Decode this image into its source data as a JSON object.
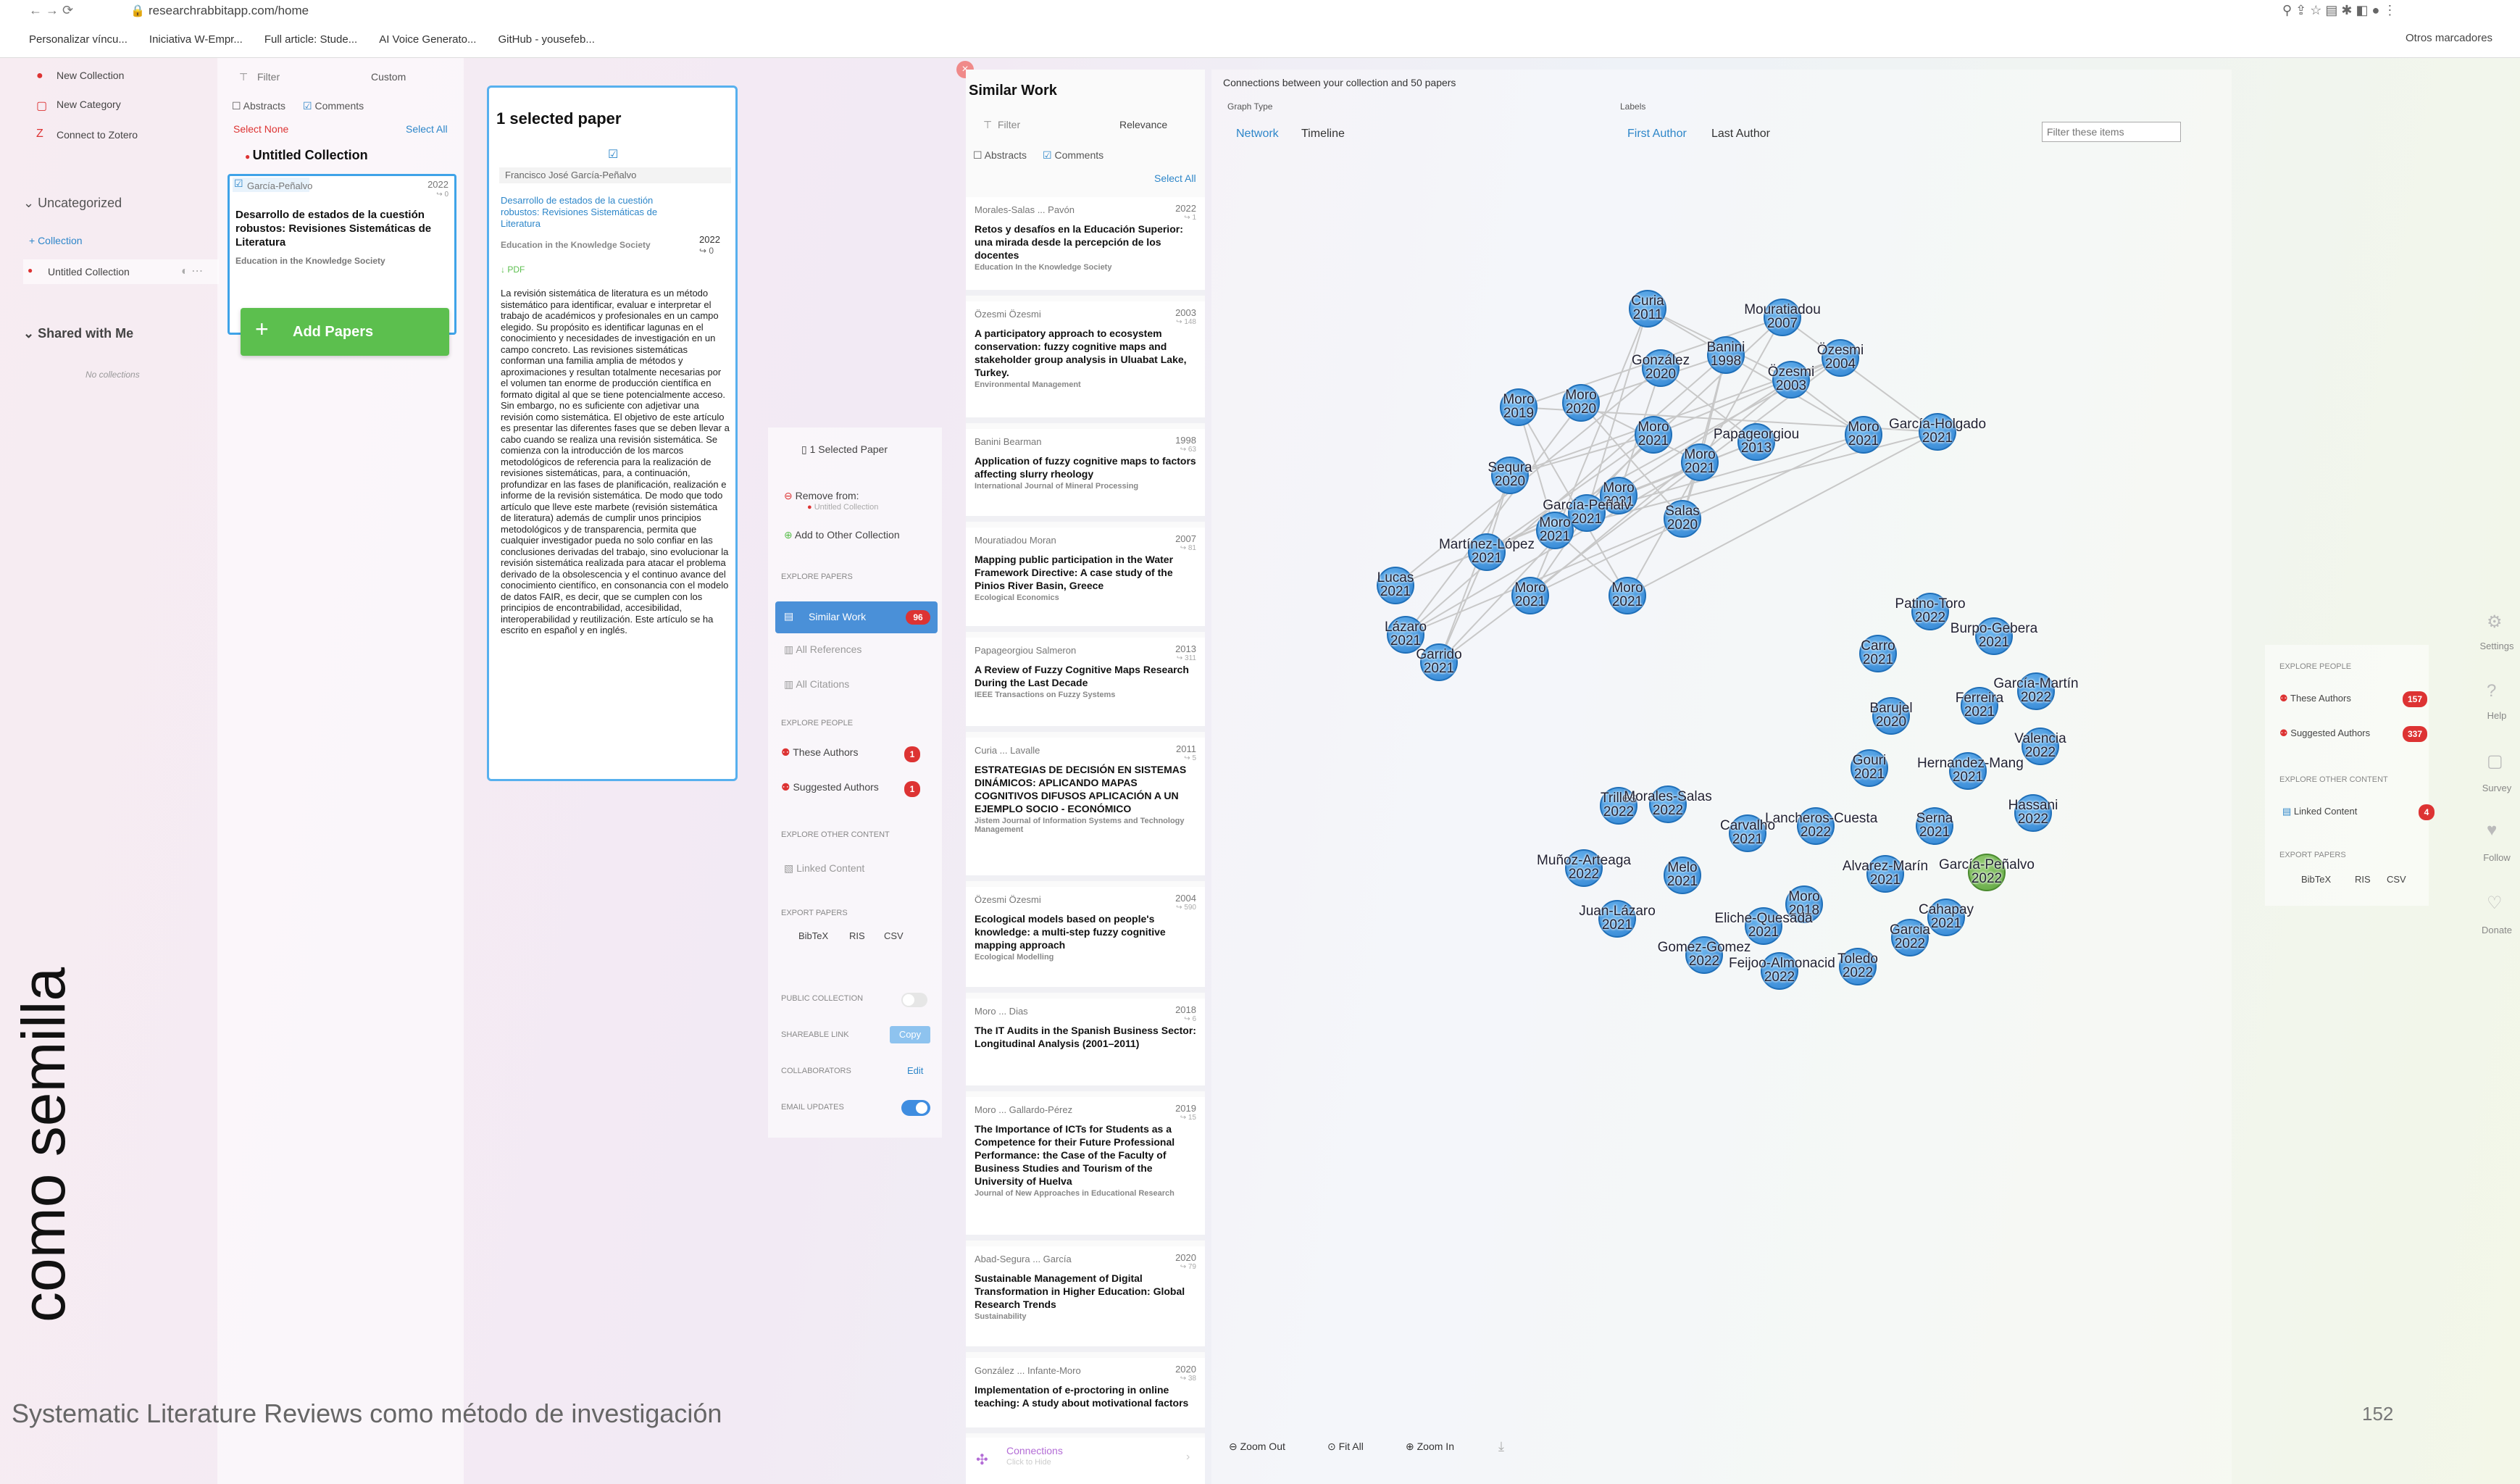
{
  "browser": {
    "url": "researchrabbitapp.com/home",
    "bookmarks": [
      "Personalizar víncu...",
      "Iniciativa W-Empr...",
      "Full article: Stude...",
      "AI Voice Generato...",
      "GitHub - yousefeb..."
    ],
    "other_bookmarks": "Otros marcadores"
  },
  "left_sidebar": {
    "new_collection": "New Collection",
    "new_category": "New Category",
    "connect_zotero": "Connect to Zotero",
    "uncategorized": "Uncategorized",
    "add_collection": "+ Collection",
    "untitled_collection": "Untitled Collection",
    "shared_with_me": "Shared with Me",
    "no_collections": "No collections"
  },
  "collection_panel": {
    "filter": "Filter",
    "sort": "Custom",
    "abstracts": "Abstracts",
    "comments": "Comments",
    "select_none": "Select None",
    "select_all": "Select All",
    "title": "Untitled Collection",
    "paper_author": "García-Peñalvo",
    "paper_year": "2022",
    "paper_cites": "0",
    "paper_title": "Desarrollo de estados de la cuestión robustos: Revisiones Sistemáticas de Literatura",
    "paper_journal": "Education in the Knowledge Society",
    "add_papers": "Add Papers"
  },
  "selected_panel": {
    "title": "1 selected paper",
    "author": "Francisco José García-Peñalvo",
    "paper_title": "Desarrollo de estados de la cuestión robustos: Revisiones Sistemáticas de Literatura",
    "journal": "Education in the Knowledge Society",
    "year": "2022",
    "cites": "0",
    "pdf": "PDF",
    "abstract": "La revisión sistemática de literatura es un método sistemático para identificar, evaluar e interpretar el trabajo de académicos y profesionales en un campo elegido. Su propósito es identificar lagunas en el conocimiento y necesidades de investigación en un campo concreto. Las revisiones sistemáticas conforman una familia amplia de métodos y aproximaciones y resultan totalmente necesarias por el volumen tan enorme de producción científica en formato digital al que se tiene potencialmente acceso. Sin embargo, no es suficiente con adjetivar una revisión como sistemática. El objetivo de este artículo es presentar las diferentes fases que se deben llevar a cabo cuando se realiza una revisión sistemática. Se comienza con la introducción de los marcos metodológicos de referencia para la realización de revisiones sistemáticas, para, a continuación, profundizar en las fases de planificación, realización e informe de la revisión sistemática. De modo que todo artículo que lleve este marbete (revisión sistemática de literatura) además de cumplir unos principios metodológicos y de transparencia, permita que cualquier investigador pueda no solo confiar en las conclusiones derivadas del trabajo, sino evolucionar la revisión sistemática realizada para atacar el problema derivado de la obsolescencia y el continuo avance del conocimiento científico, en consonancia con el modelo de datos FAIR, es decir, que se cumplen con los principios de encontrabilidad, accesibilidad, interoperabilidad y reutilización. Este artículo se ha escrito en español y en inglés."
  },
  "actions_panel": {
    "selected": "1 Selected Paper",
    "remove_from": "Remove from:",
    "remove_collection": "Untitled Collection",
    "add_other": "Add to Other Collection",
    "explore_papers": "EXPLORE PAPERS",
    "similar_work": "Similar Work",
    "similar_count": "96",
    "all_references": "All References",
    "all_citations": "All Citations",
    "explore_people": "EXPLORE PEOPLE",
    "these_authors": "These Authors",
    "these_count": "1",
    "suggested_authors": "Suggested Authors",
    "suggested_count": "1",
    "explore_other": "EXPLORE OTHER CONTENT",
    "linked_content": "Linked Content",
    "export_papers": "EXPORT PAPERS",
    "bibtex": "BibTeX",
    "ris": "RIS",
    "csv": "CSV",
    "public_collection": "PUBLIC COLLECTION",
    "shareable_link": "SHAREABLE LINK",
    "copy": "Copy",
    "collaborators": "COLLABORATORS",
    "edit": "Edit",
    "email_updates": "EMAIL UPDATES"
  },
  "similar_panel": {
    "title": "Similar Work",
    "filter": "Filter",
    "sort": "Relevance",
    "abstracts": "Abstracts",
    "comments": "Comments",
    "select_all": "Select All",
    "connections": "Connections",
    "click_hide": "Click to Hide",
    "items": [
      {
        "authors": "Morales-Salas  ...  Pavón",
        "year": "2022",
        "cites": "1",
        "title": "Retos y desafíos en la Educación Superior: una mirada desde la percepción de los docentes",
        "journal": "Education In the Knowledge Society"
      },
      {
        "authors": "Özesmi   Özesmi",
        "year": "2003",
        "cites": "148",
        "title": "A participatory approach to ecosystem conservation: fuzzy cognitive maps and stakeholder group analysis in Uluabat Lake, Turkey.",
        "journal": "Environmental Management"
      },
      {
        "authors": "Banini   Bearman",
        "year": "1998",
        "cites": "63",
        "title": "Application of fuzzy cognitive maps to factors affecting slurry rheology",
        "journal": "International Journal of Mineral Processing"
      },
      {
        "authors": "Mouratiadou   Moran",
        "year": "2007",
        "cites": "81",
        "title": "Mapping public participation in the Water Framework Directive: A case study of the Pinios River Basin, Greece",
        "journal": "Ecological Economics"
      },
      {
        "authors": "Papageorgiou   Salmeron",
        "year": "2013",
        "cites": "311",
        "title": "A Review of Fuzzy Cognitive Maps Research During the Last Decade",
        "journal": "IEEE Transactions on Fuzzy Systems"
      },
      {
        "authors": "Curia  ...  Lavalle",
        "year": "2011",
        "cites": "5",
        "title": "ESTRATEGIAS DE DECISIÓN EN SISTEMAS DINÁMICOS: APLICANDO MAPAS COGNITIVOS DIFUSOS APLICACIÓN A UN EJEMPLO SOCIO - ECONÓMICO",
        "journal": "Jistem Journal of Information Systems and Technology Management"
      },
      {
        "authors": "Özesmi   Özesmi",
        "year": "2004",
        "cites": "590",
        "title": "Ecological models based on people's knowledge: a multi-step fuzzy cognitive mapping approach",
        "journal": "Ecological Modelling"
      },
      {
        "authors": "Moro  ...  Dias",
        "year": "2018",
        "cites": "6",
        "title": "The IT Audits in the Spanish Business Sector: Longitudinal Analysis (2001–2011)",
        "journal": ""
      },
      {
        "authors": "Moro  ...  Gallardo-Pérez",
        "year": "2019",
        "cites": "15",
        "title": "The Importance of ICTs for Students as a Competence for their Future Professional Performance: the Case of the Faculty of Business Studies and Tourism of the University of Huelva",
        "journal": "Journal of New Approaches in Educational Research"
      },
      {
        "authors": "Abad-Segura  ...  García",
        "year": "2020",
        "cites": "79",
        "title": "Sustainable Management of Digital Transformation in Higher Education: Global Research Trends",
        "journal": "Sustainability"
      },
      {
        "authors": "González  ...  Infante-Moro",
        "year": "2020",
        "cites": "38",
        "title": "Implementation of e-proctoring in online teaching: A study about motivational factors",
        "journal": ""
      }
    ]
  },
  "graph_panel": {
    "header": "Connections between your collection and 50 papers",
    "graph_type": "Graph Type",
    "network": "Network",
    "timeline": "Timeline",
    "labels": "Labels",
    "first_author": "First Author",
    "last_author": "Last Author",
    "filter_placeholder": "Filter these items",
    "zoom_out": "Zoom Out",
    "fit_all": "Fit All",
    "zoom_in": "Zoom In",
    "nodes": [
      {
        "name": "Curia",
        "year": "2011"
      },
      {
        "name": "Mouratiadou",
        "year": "2007"
      },
      {
        "name": "Banini",
        "year": "1998"
      },
      {
        "name": "Özesmi",
        "year": "2004"
      },
      {
        "name": "González",
        "year": "2020"
      },
      {
        "name": "Özesmi",
        "year": "2003"
      },
      {
        "name": "Moro",
        "year": "2019"
      },
      {
        "name": "Moro",
        "year": "2020"
      },
      {
        "name": "Moro",
        "year": "2021"
      },
      {
        "name": "Papageorgiou",
        "year": "2013"
      },
      {
        "name": "Moro",
        "year": "2021"
      },
      {
        "name": "García-Holgado",
        "year": "2021"
      },
      {
        "name": "Moro",
        "year": "2021"
      },
      {
        "name": "Sequra",
        "year": "2020"
      },
      {
        "name": "Moro",
        "year": "2021"
      },
      {
        "name": "García-Peñalv",
        "year": "2021"
      },
      {
        "name": "Moro",
        "year": "2021"
      },
      {
        "name": "Salas",
        "year": "2020"
      },
      {
        "name": "Martínez-López",
        "year": "2021"
      },
      {
        "name": "Lucas",
        "year": "2021"
      },
      {
        "name": "Moro",
        "year": "2021"
      },
      {
        "name": "Moro",
        "year": "2021"
      },
      {
        "name": "Lázaro",
        "year": "2021"
      },
      {
        "name": "Garrido",
        "year": "2021"
      },
      {
        "name": "Patino-Toro",
        "year": "2022"
      },
      {
        "name": "Burpo-Gebera",
        "year": "2021"
      },
      {
        "name": "Carro",
        "year": "2021"
      },
      {
        "name": "García-Martín",
        "year": "2022"
      },
      {
        "name": "Barujel",
        "year": "2020"
      },
      {
        "name": "Ferreira",
        "year": "2021"
      },
      {
        "name": "Valencia",
        "year": "2022"
      },
      {
        "name": "Gouri",
        "year": "2021"
      },
      {
        "name": "Hernandez-Mang",
        "year": "2021"
      },
      {
        "name": "Trilles",
        "year": "2022"
      },
      {
        "name": "Morales-Salas",
        "year": "2022"
      },
      {
        "name": "Hassani",
        "year": "2022"
      },
      {
        "name": "Lancheros-Cuesta",
        "year": "2022"
      },
      {
        "name": "Carvalho",
        "year": "2021"
      },
      {
        "name": "Serna",
        "year": "2021"
      },
      {
        "name": "Muñoz-Arteaga",
        "year": "2022"
      },
      {
        "name": "Melo",
        "year": "2021"
      },
      {
        "name": "Alvarez-Marín",
        "year": "2021"
      },
      {
        "name": "García-Peñalvo",
        "year": "2022"
      },
      {
        "name": "Moro",
        "year": "2018"
      },
      {
        "name": "Juan-Lázaro",
        "year": "2021"
      },
      {
        "name": "Eliche-Quesada",
        "year": "2021"
      },
      {
        "name": "Cahapay",
        "year": "2021"
      },
      {
        "name": "Garcia",
        "year": "2022"
      },
      {
        "name": "Gomez-Gomez",
        "year": "2022"
      },
      {
        "name": "Feijoo-Almonacid",
        "year": "2022"
      },
      {
        "name": "Toledo",
        "year": "2022"
      }
    ]
  },
  "right_panel": {
    "explore_people": "EXPLORE PEOPLE",
    "these_authors": "These Authors",
    "these_count": "157",
    "suggested_authors": "Suggested Authors",
    "suggested_count": "337",
    "explore_other": "EXPLORE OTHER CONTENT",
    "linked_content": "Linked Content",
    "linked_count": "4",
    "export_papers": "EXPORT PAPERS",
    "bibtex": "BibTeX",
    "ris": "RIS",
    "csv": "CSV"
  },
  "right_rail": {
    "settings": "Settings",
    "help": "Help",
    "survey": "Survey",
    "follow": "Follow",
    "donate": "Donate"
  },
  "slide": {
    "vertical_text": "como semilla",
    "footer": "Systematic Literature Reviews como método de investigación",
    "page": "152"
  }
}
